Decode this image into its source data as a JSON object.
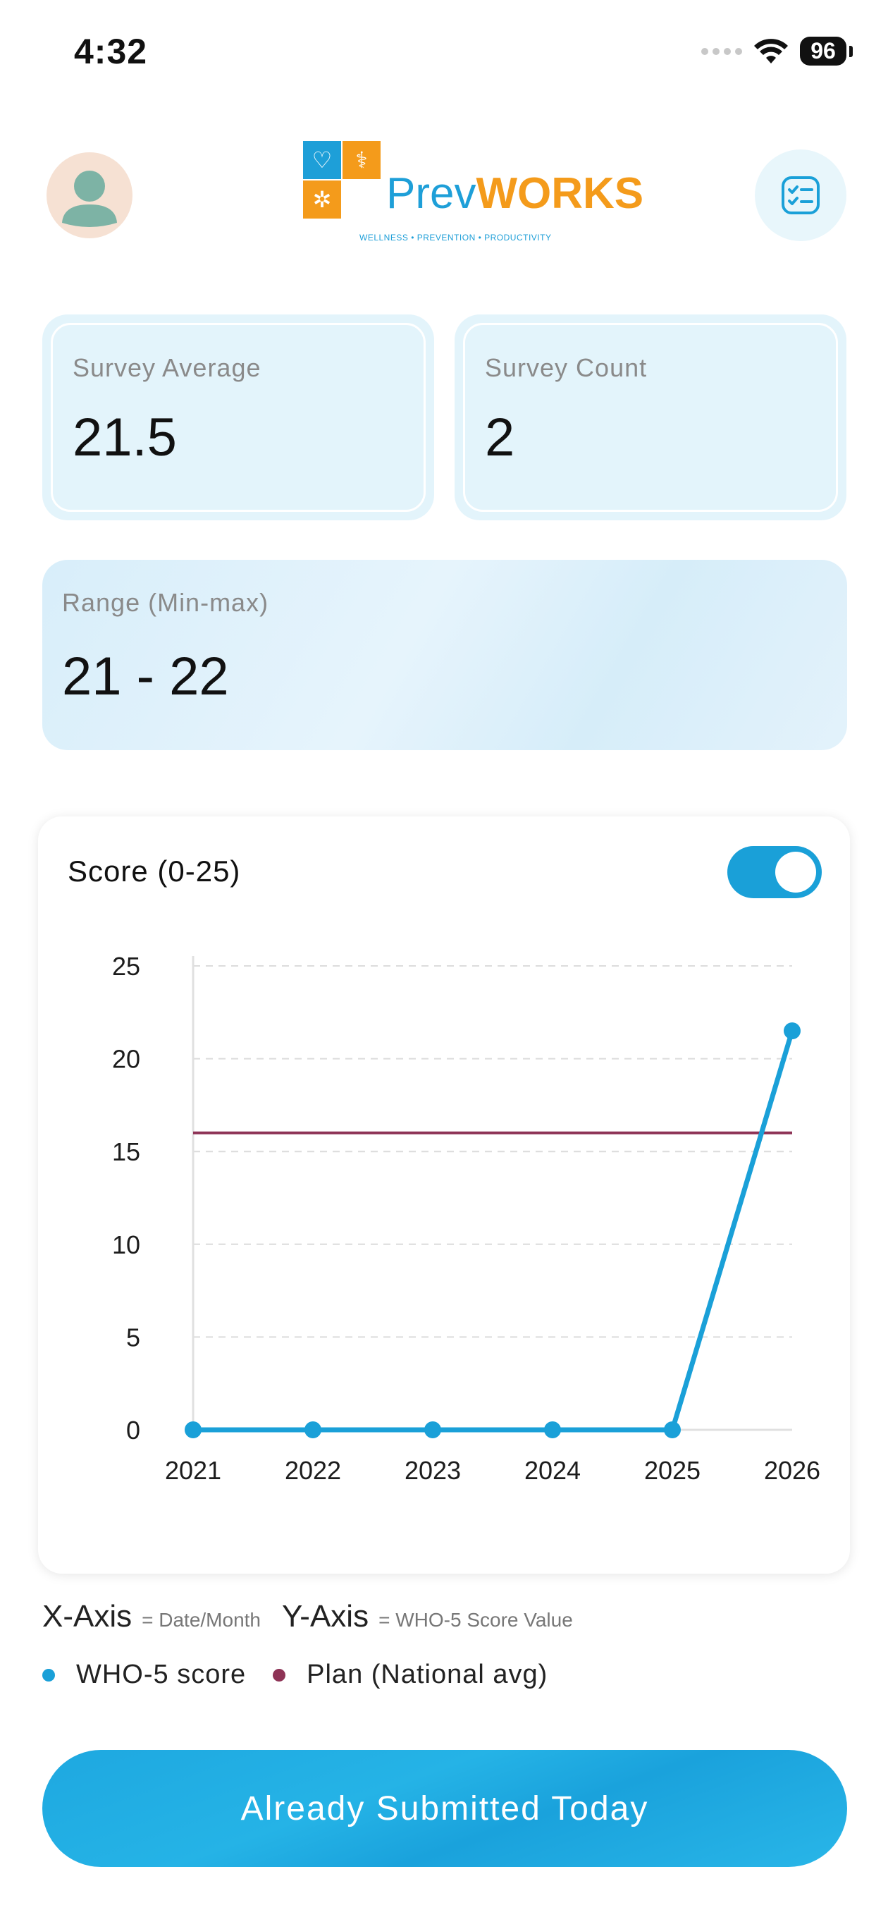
{
  "status_bar": {
    "time": "4:32",
    "battery": "96"
  },
  "header": {
    "logo": {
      "prefix": "Prev",
      "emphasis": "WORKS",
      "tagline": "WELLNESS • PREVENTION • PRODUCTIVITY"
    },
    "icons": {
      "avatar": "user-avatar-icon",
      "action": "checklist-icon"
    }
  },
  "stats": {
    "average": {
      "label": "Survey Average",
      "value": "21.5"
    },
    "count": {
      "label": "Survey Count",
      "value": "2"
    },
    "range": {
      "label": "Range (Min-max)",
      "value": "21 - 22"
    }
  },
  "chart": {
    "title": "Score (0-25)",
    "toggle_on": true
  },
  "chart_data": {
    "type": "line",
    "categories": [
      "2021",
      "2022",
      "2023",
      "2024",
      "2025",
      "2026"
    ],
    "series": [
      {
        "name": "WHO-5 score",
        "values": [
          0,
          0,
          0,
          0,
          0,
          21.5
        ],
        "color": "#1aa0d8"
      },
      {
        "name": "Plan (National avg)",
        "values": [
          16,
          16,
          16,
          16,
          16,
          16
        ],
        "color": "#8e3356"
      }
    ],
    "y_ticks": [
      "0",
      "5",
      "10",
      "15",
      "20",
      "25"
    ],
    "ylim": [
      0,
      25
    ],
    "grid": true,
    "xlabel": "",
    "ylabel": ""
  },
  "axes_description": {
    "x_label": "X-Axis",
    "x_desc": "= Date/Month",
    "y_label": "Y-Axis",
    "y_desc": "= WHO-5 Score Value"
  },
  "legend": [
    {
      "label": "WHO-5 score",
      "color": "#1aa0d8"
    },
    {
      "label": "Plan (National avg)",
      "color": "#8e3356"
    }
  ],
  "submit_button": {
    "label": "Already Submitted Today"
  }
}
